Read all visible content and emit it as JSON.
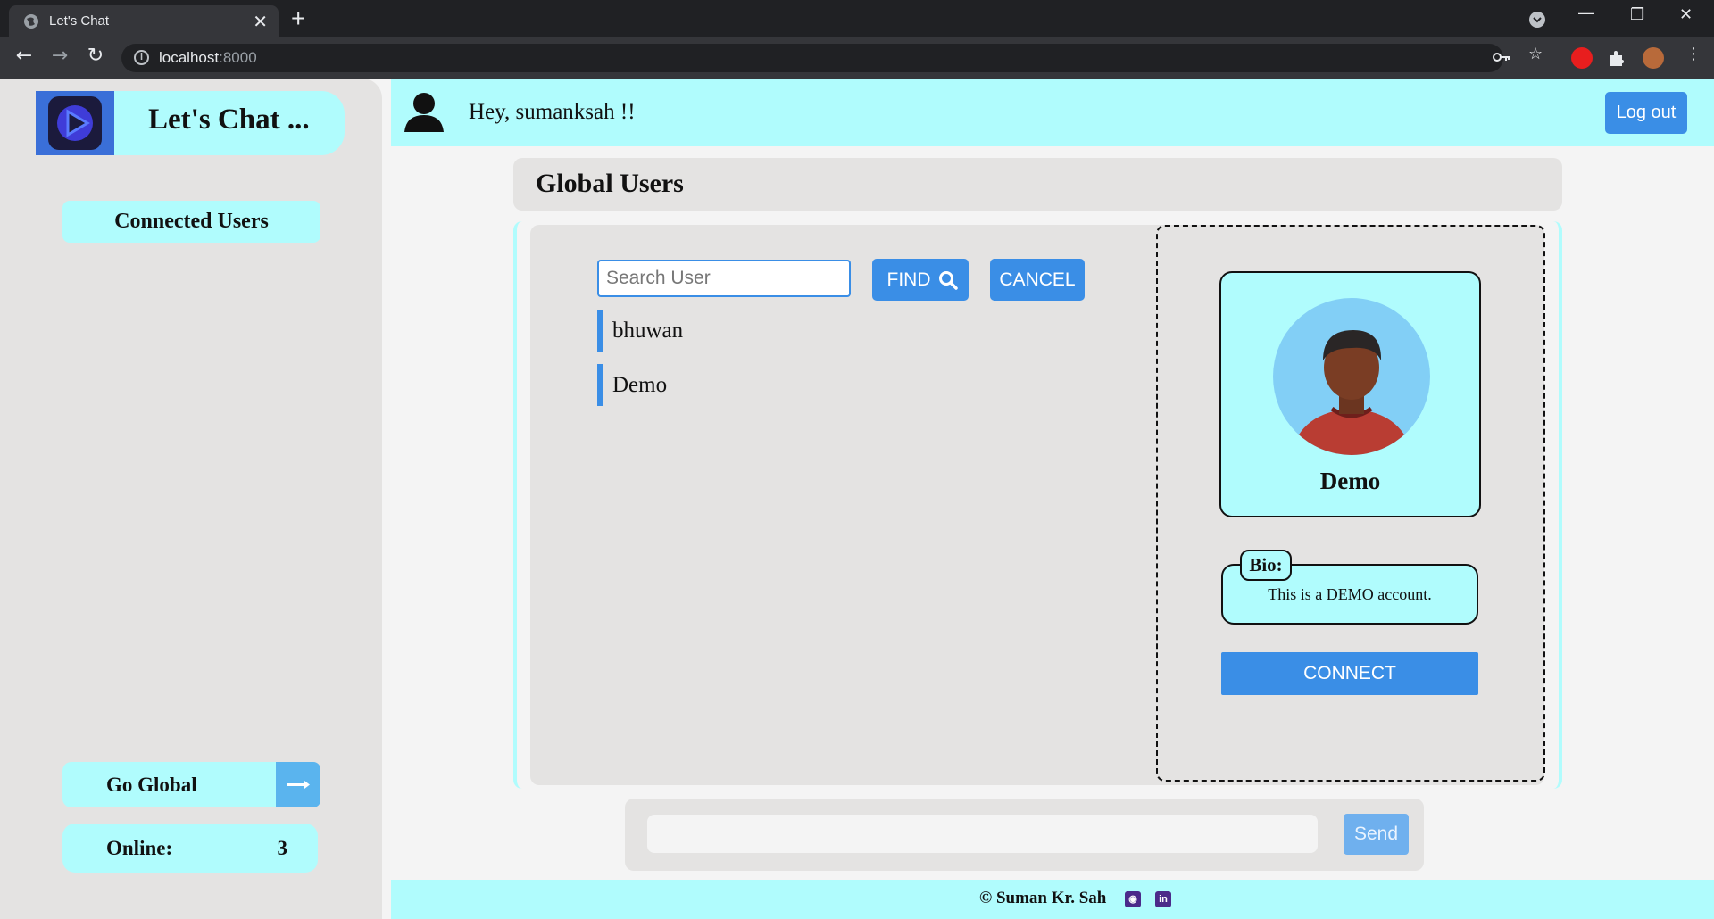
{
  "browser": {
    "tab_title": "Let's Chat",
    "tab_close": "✕",
    "new_tab": "+",
    "url_host": "localhost",
    "url_port": ":8000",
    "win_minimize": "—",
    "win_restore": "❐",
    "win_close": "✕"
  },
  "sidebar": {
    "brand_title": "Let's Chat ...",
    "connected_users_label": "Connected Users",
    "go_global_label": "Go Global",
    "online_label": "Online:",
    "online_count": "3"
  },
  "header": {
    "greeting": "Hey, sumanksah !!",
    "logout_label": "Log out"
  },
  "panel": {
    "title": "Global Users",
    "search_placeholder": "Search User",
    "find_label": "FIND",
    "cancel_label": "CANCEL",
    "users": [
      "bhuwan",
      "Demo"
    ]
  },
  "profile": {
    "name": "Demo",
    "bio_label": "Bio:",
    "bio_text": "This is a DEMO account.",
    "connect_label": "CONNECT"
  },
  "composer": {
    "send_label": "Send"
  },
  "footer": {
    "copyright": "© Suman Kr. Sah",
    "github_icon_glyph": "◉",
    "linkedin_icon_glyph": "in"
  },
  "colors": {
    "accent_cyan": "#b0fcfd",
    "button_blue": "#3a8ee6",
    "panel_gray": "#e4e3e2"
  }
}
